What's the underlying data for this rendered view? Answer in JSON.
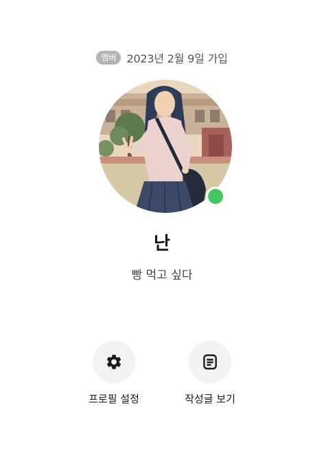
{
  "membership": {
    "badge": "멤버",
    "joined_text": "2023년 2월 9일 가입"
  },
  "profile": {
    "nickname": "난",
    "status_message": "빵 먹고 싶다",
    "online": true,
    "online_color": "#46c562"
  },
  "actions": [
    {
      "label": "프로필 설정",
      "icon": "gear-icon"
    },
    {
      "label": "작성글 보기",
      "icon": "document-icon"
    }
  ]
}
